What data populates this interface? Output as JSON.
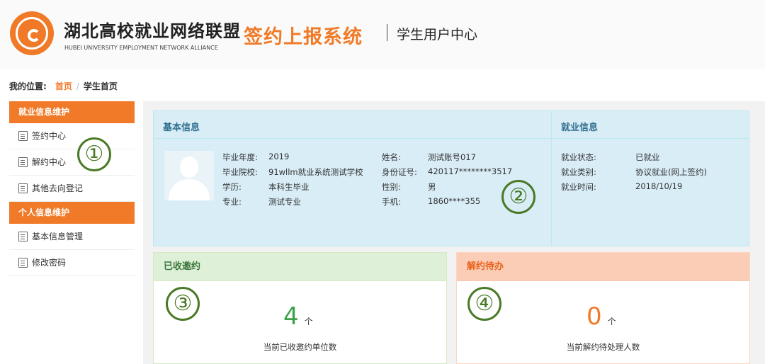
{
  "header": {
    "brand_cn": "湖北高校就业网络联盟",
    "brand_en": "HUBEI UNIVERSITY EMPLOYMENT NETWORK ALLIANCE",
    "system_name": "签约上报系统",
    "center_name": "学生用户中心",
    "accent_color": "#f07a27"
  },
  "breadcrumb": {
    "label": "我的位置:",
    "home": "首页",
    "separator": "/",
    "current": "学生首页"
  },
  "sidebar": {
    "sections": [
      {
        "title": "就业信息维护",
        "items": [
          {
            "label": "签约中心",
            "icon": "document-edit-icon"
          },
          {
            "label": "解约中心",
            "icon": "document-icon"
          },
          {
            "label": "其他去向登记",
            "icon": "document-icon"
          }
        ]
      },
      {
        "title": "个人信息维护",
        "items": [
          {
            "label": "基本信息管理",
            "icon": "list-icon"
          },
          {
            "label": "修改密码",
            "icon": "edit-icon"
          }
        ]
      }
    ]
  },
  "basic_info": {
    "title": "基本信息",
    "fields": [
      {
        "label": "毕业年度:",
        "value": "2019"
      },
      {
        "label": "毕业院校:",
        "value": "91wllm就业系统测试学校"
      },
      {
        "label": "学历:",
        "value": "本科生毕业"
      },
      {
        "label": "专业:",
        "value": "测试专业"
      },
      {
        "label": "姓名:",
        "value": "测试账号017"
      },
      {
        "label": "身份证号:",
        "value": "420117********3517"
      },
      {
        "label": "性别:",
        "value": "男"
      },
      {
        "label": "手机:",
        "value": "1860****355"
      }
    ]
  },
  "employment_info": {
    "title": "就业信息",
    "fields": [
      {
        "label": "就业状态:",
        "value": "已就业"
      },
      {
        "label": "就业类别:",
        "value": "协议就业(网上签约)"
      },
      {
        "label": "就业时间:",
        "value": "2018/10/19"
      }
    ]
  },
  "received_offers": {
    "title": "已收邀约",
    "count": "4",
    "unit": "个",
    "description": "当前已收邀约单位数",
    "color": "#3ca14a"
  },
  "pending_cancellations": {
    "title": "解约待办",
    "count": "0",
    "unit": "个",
    "description": "当前解约待处理人数",
    "color": "#f07a27"
  },
  "annotations": [
    "①",
    "②",
    "③",
    "④"
  ]
}
